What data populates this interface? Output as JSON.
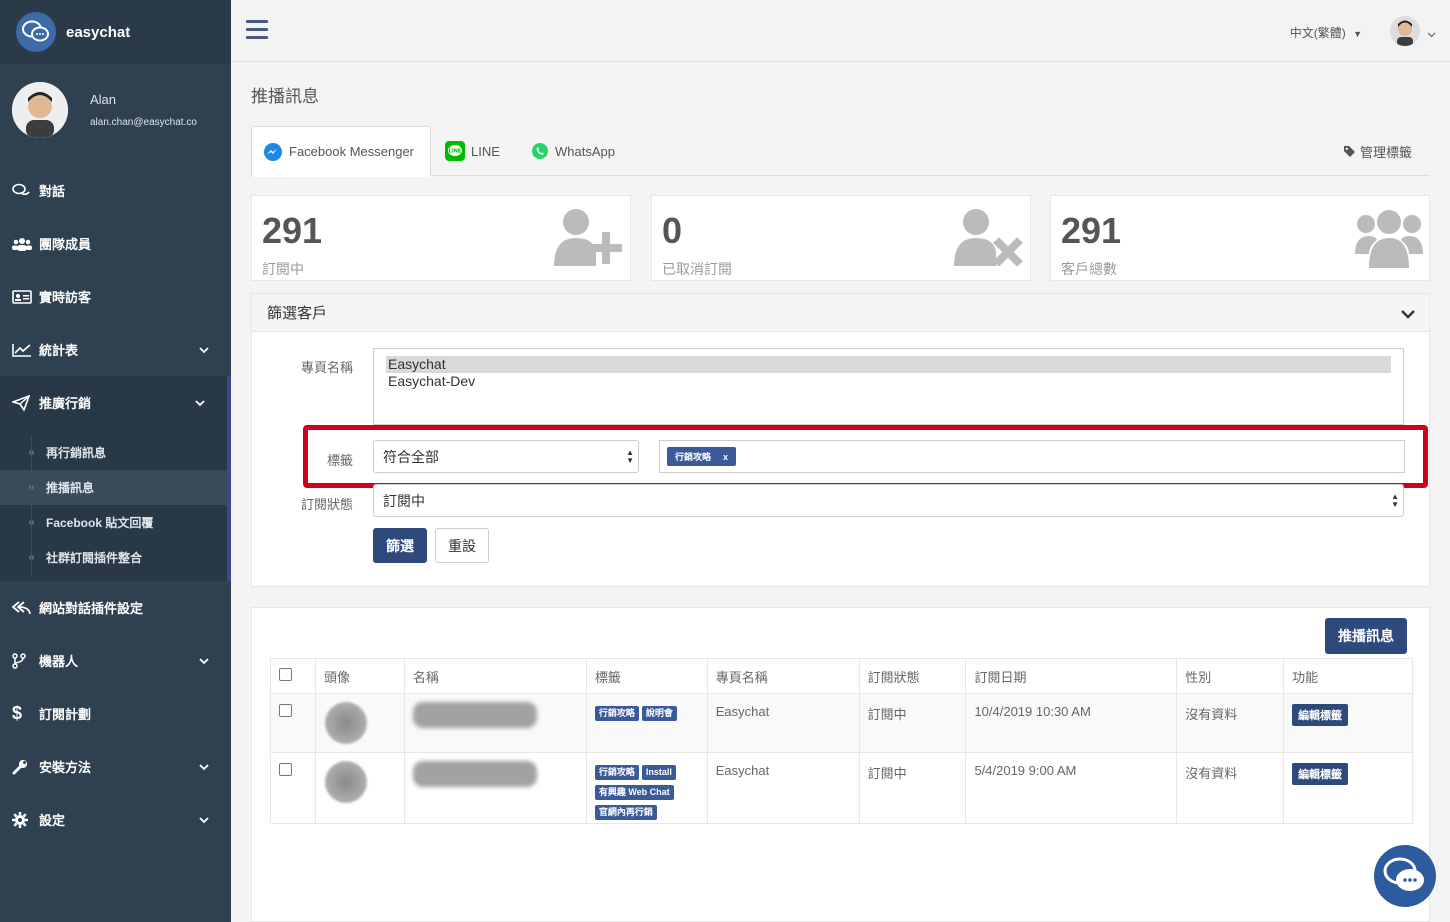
{
  "brand": {
    "name": "easychat"
  },
  "user": {
    "name": "Alan",
    "email": "alan.chan@easychat.co"
  },
  "sidebar": {
    "items": [
      {
        "label": "對話",
        "icon": "chat-icon",
        "has_chevron": false
      },
      {
        "label": "團隊成員",
        "icon": "team-icon",
        "has_chevron": false
      },
      {
        "label": "實時訪客",
        "icon": "id-card-icon",
        "has_chevron": false
      },
      {
        "label": "統計表",
        "icon": "chart-icon",
        "has_chevron": true
      },
      {
        "label": "推廣行銷",
        "icon": "paper-plane-icon",
        "has_chevron": true,
        "active": true
      },
      {
        "label": "網站對話插件設定",
        "icon": "reply-all-icon",
        "has_chevron": false
      },
      {
        "label": "機器人",
        "icon": "code-branch-icon",
        "has_chevron": true
      },
      {
        "label": "訂閱計劃",
        "icon": "dollar-icon",
        "has_chevron": false
      },
      {
        "label": "安裝方法",
        "icon": "wrench-icon",
        "has_chevron": true
      },
      {
        "label": "設定",
        "icon": "gear-icon",
        "has_chevron": true
      }
    ],
    "subitems": [
      {
        "label": "再行銷訊息"
      },
      {
        "label": "推播訊息",
        "current": true
      },
      {
        "label": "Facebook 貼文回覆"
      },
      {
        "label": "社群訂閱插件整合"
      }
    ]
  },
  "topbar": {
    "language": "中文(繁體)"
  },
  "page": {
    "title": "推播訊息"
  },
  "tabs": [
    {
      "label": "Facebook Messenger",
      "icon": "messenger-icon",
      "active": true
    },
    {
      "label": "LINE",
      "icon": "line-icon"
    },
    {
      "label": "WhatsApp",
      "icon": "whatsapp-icon"
    }
  ],
  "manage_tags": {
    "label": "管理標籤",
    "icon": "tag-icon"
  },
  "stats": [
    {
      "value": "291",
      "label": "訂閱中",
      "icon": "user-plus-icon"
    },
    {
      "value": "0",
      "label": "已取消訂閱",
      "icon": "user-times-icon"
    },
    {
      "value": "291",
      "label": "客戶總數",
      "icon": "users-icon"
    }
  ],
  "filter": {
    "title": "篩選客戶",
    "page_label": "專頁名稱",
    "pages": [
      {
        "name": "Easychat",
        "selected": true
      },
      {
        "name": "Easychat-Dev",
        "selected": false
      }
    ],
    "tag_label": "標籤",
    "tag_match": "符合全部",
    "tag_chip": "行銷攻略",
    "tag_chip_remove": "x",
    "status_label": "訂閱狀態",
    "status_value": "訂閱中",
    "submit": "篩選",
    "reset": "重設"
  },
  "broadcast_button": "推播訊息",
  "table": {
    "headers": [
      "頭像",
      "名稱",
      "標籤",
      "專頁名稱",
      "訂閱狀態",
      "訂閱日期",
      "性別",
      "功能"
    ],
    "rows": [
      {
        "tags": [
          "行銷攻略",
          "說明會"
        ],
        "page": "Easychat",
        "status": "訂閱中",
        "date": "10/4/2019 10:30 AM",
        "gender": "沒有資料",
        "action": "編輯標籤"
      },
      {
        "tags": [
          "行銷攻略",
          "Install",
          "有興趣 Web Chat",
          "官網內再行銷"
        ],
        "page": "Easychat",
        "status": "訂閱中",
        "date": "5/4/2019 9:00 AM",
        "gender": "沒有資料",
        "action": "編輯標籤"
      }
    ]
  },
  "colors": {
    "sidebar_bg": "#2f4050",
    "primary": "#2e4a7c",
    "tag_bg": "#3a5a9a",
    "highlight": "#d0021b"
  }
}
